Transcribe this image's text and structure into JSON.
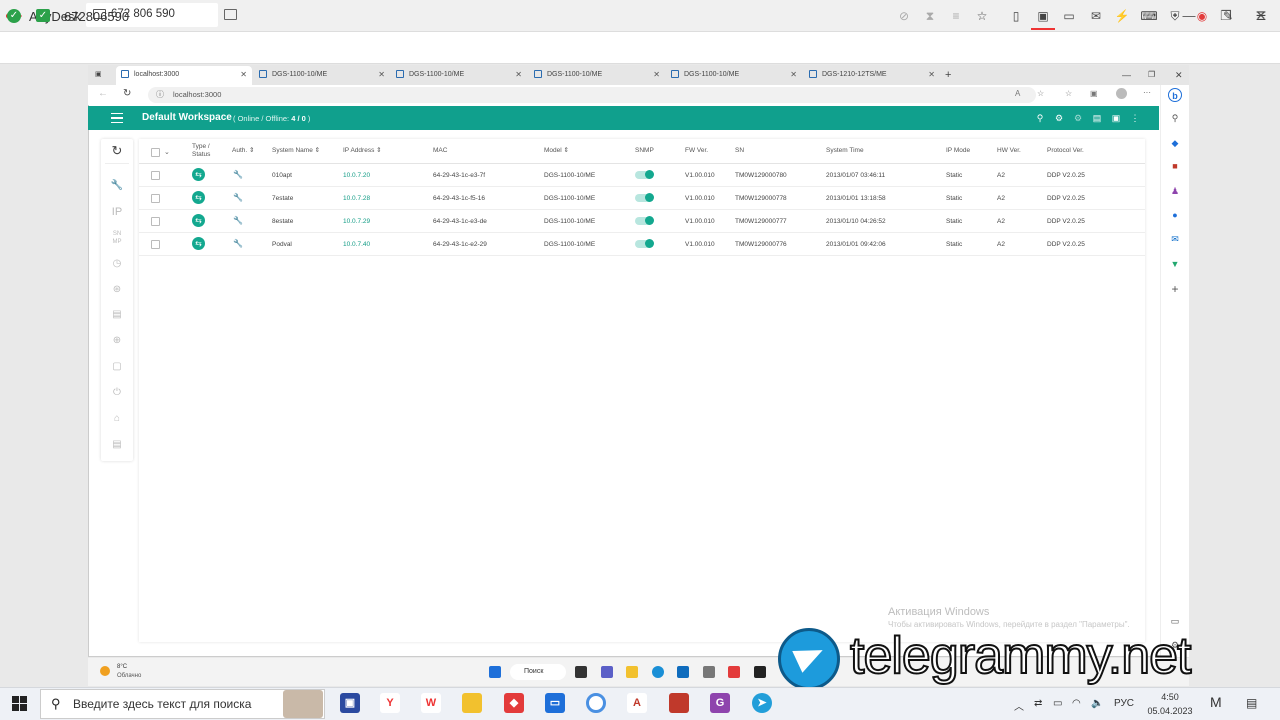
{
  "anydesk": {
    "app_name": "AnyDesk",
    "tab_address": "672 806 590",
    "session_id": "672806590"
  },
  "browser": {
    "tabs": [
      {
        "label": "localhost:3000"
      },
      {
        "label": "DGS-1100-10/ME"
      },
      {
        "label": "DGS-1100-10/ME"
      },
      {
        "label": "DGS-1100-10/ME"
      },
      {
        "label": "DGS-1100-10/ME"
      },
      {
        "label": "DGS-1210-12TS/ME"
      }
    ],
    "address": "localhost:3000"
  },
  "app": {
    "workspace_title": "Default Workspace",
    "online_offline_label": "( Online / Offline: ",
    "online_offline_value": "4 / 0",
    "online_offline_close": " )"
  },
  "table": {
    "headers": {
      "type_status_1": "Type /",
      "type_status_2": "Status",
      "auth": "Auth.",
      "system_name": "System Name",
      "ip": "IP Address",
      "mac": "MAC",
      "model": "Model",
      "snmp": "SNMP",
      "fw": "FW Ver.",
      "sn": "SN",
      "system_time": "System Time",
      "ip_mode": "IP Mode",
      "hw": "HW Ver.",
      "protocol": "Protocol Ver."
    },
    "rows": [
      {
        "name": "010apt",
        "ip": "10.0.7.20",
        "mac": "64-29-43-1c-e3-7f",
        "model": "DGS-1100-10/ME",
        "snmp": true,
        "fw": "V1.00.010",
        "sn": "TM0W129000780",
        "time": "2013/01/07 03:46:11",
        "ip_mode": "Static",
        "hw": "A2",
        "protocol": "DDP V2.0.25"
      },
      {
        "name": "7estate",
        "ip": "10.0.7.28",
        "mac": "64-29-43-1c-f5-16",
        "model": "DGS-1100-10/ME",
        "snmp": true,
        "fw": "V1.00.010",
        "sn": "TM0W129000778",
        "time": "2013/01/01 13:18:58",
        "ip_mode": "Static",
        "hw": "A2",
        "protocol": "DDP V2.0.25"
      },
      {
        "name": "8estate",
        "ip": "10.0.7.29",
        "mac": "64-29-43-1c-e3-de",
        "model": "DGS-1100-10/ME",
        "snmp": true,
        "fw": "V1.00.010",
        "sn": "TM0W129000777",
        "time": "2013/01/10 04:26:52",
        "ip_mode": "Static",
        "hw": "A2",
        "protocol": "DDP V2.0.25"
      },
      {
        "name": "Podval",
        "ip": "10.0.7.40",
        "mac": "64-29-43-1c-e2-29",
        "model": "DGS-1100-10/ME",
        "snmp": true,
        "fw": "V1.00.010",
        "sn": "TM0W129000776",
        "time": "2013/01/01 09:42:06",
        "ip_mode": "Static",
        "hw": "A2",
        "protocol": "DDP V2.0.25"
      }
    ]
  },
  "watermark": {
    "line1": "Активация Windows",
    "line2": "Чтобы активировать Windows, перейдите в раздел \"Параметры\"."
  },
  "inner_taskbar": {
    "temp": "8°C",
    "weather": "Облачно",
    "search": "Поиск"
  },
  "overlay": {
    "text": "telegrammy.net"
  },
  "taskbar": {
    "search_placeholder": "Введите здесь текст для поиска",
    "lang": "РУС",
    "time": "4:50",
    "date": "05.04.2023"
  },
  "colors": {
    "accent": "#10a08d",
    "anydesk_red": "#e33b3b",
    "ok_green": "#2ca14a"
  }
}
